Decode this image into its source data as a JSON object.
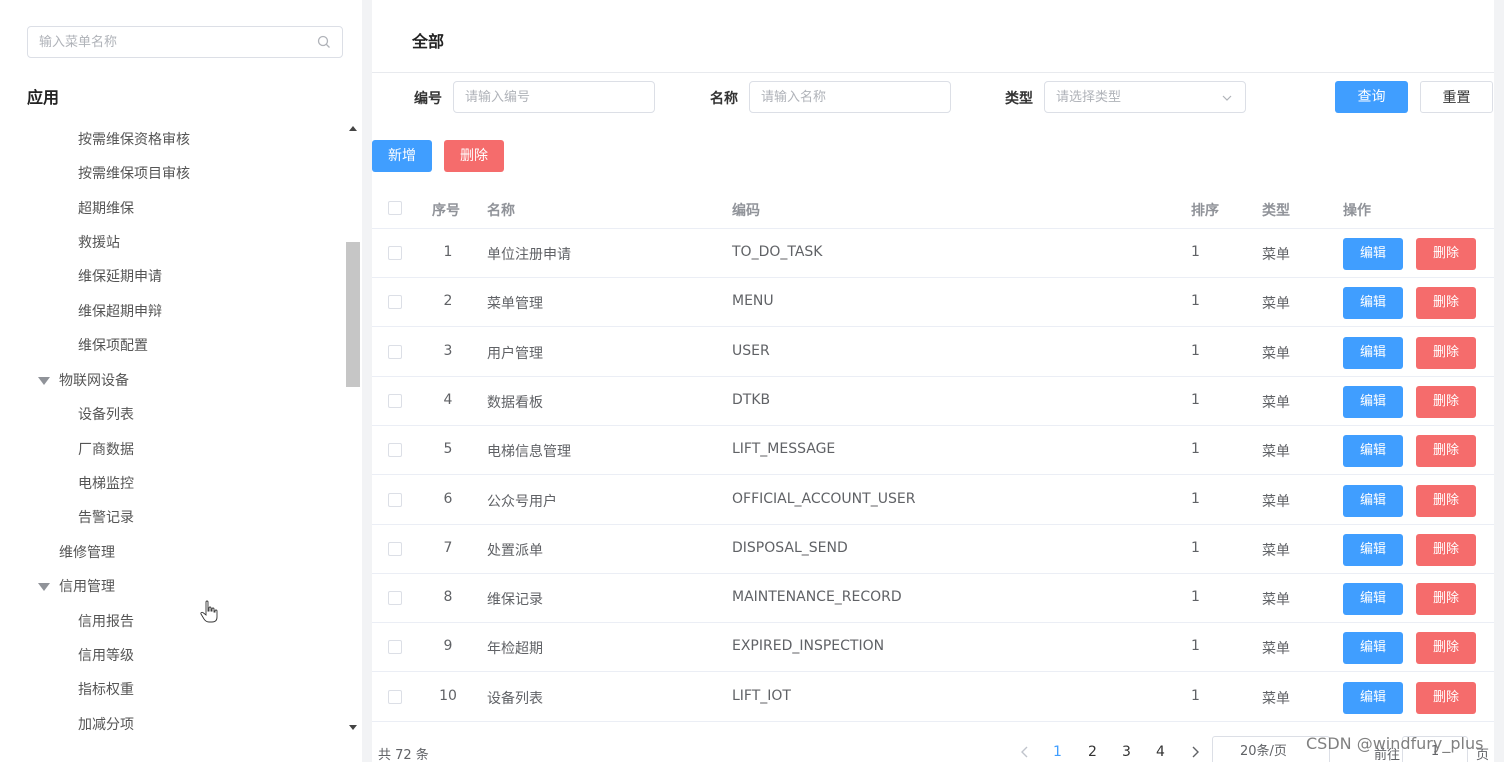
{
  "sidebar": {
    "search_placeholder": "输入菜单名称",
    "section_title": "应用",
    "tree": [
      {
        "label": "按需维保资格审核",
        "level": 2
      },
      {
        "label": "按需维保项目审核",
        "level": 2
      },
      {
        "label": "超期维保",
        "level": 2
      },
      {
        "label": "救援站",
        "level": 2
      },
      {
        "label": "维保延期申请",
        "level": 2
      },
      {
        "label": "维保超期申辩",
        "level": 2
      },
      {
        "label": "维保项配置",
        "level": 2
      },
      {
        "label": "物联网设备",
        "level": 1,
        "expanded": true
      },
      {
        "label": "设备列表",
        "level": 2
      },
      {
        "label": "厂商数据",
        "level": 2
      },
      {
        "label": "电梯监控",
        "level": 2
      },
      {
        "label": "告警记录",
        "level": 2
      },
      {
        "label": "维修管理",
        "level": 1
      },
      {
        "label": "信用管理",
        "level": 1,
        "expanded": true
      },
      {
        "label": "信用报告",
        "level": 2
      },
      {
        "label": "信用等级",
        "level": 2
      },
      {
        "label": "指标权重",
        "level": 2
      },
      {
        "label": "加减分项",
        "level": 2
      }
    ]
  },
  "main": {
    "title": "全部",
    "filters": {
      "code_label": "编号",
      "code_placeholder": "请输入编号",
      "name_label": "名称",
      "name_placeholder": "请输入名称",
      "type_label": "类型",
      "type_placeholder": "请选择类型",
      "query_label": "查询",
      "reset_label": "重置"
    },
    "toolbar": {
      "add_label": "新增",
      "delete_label": "删除"
    },
    "table": {
      "headers": {
        "index": "序号",
        "name": "名称",
        "code": "编码",
        "sort": "排序",
        "type": "类型",
        "ops": "操作"
      },
      "edit_label": "编辑",
      "delete_label": "删除",
      "rows": [
        {
          "index": "1",
          "name": "单位注册申请",
          "code": "TO_DO_TASK",
          "sort": "1",
          "type": "菜单"
        },
        {
          "index": "2",
          "name": "菜单管理",
          "code": "MENU",
          "sort": "1",
          "type": "菜单"
        },
        {
          "index": "3",
          "name": "用户管理",
          "code": "USER",
          "sort": "1",
          "type": "菜单"
        },
        {
          "index": "4",
          "name": "数据看板",
          "code": "DTKB",
          "sort": "1",
          "type": "菜单"
        },
        {
          "index": "5",
          "name": "电梯信息管理",
          "code": "LIFT_MESSAGE",
          "sort": "1",
          "type": "菜单"
        },
        {
          "index": "6",
          "name": "公众号用户",
          "code": "OFFICIAL_ACCOUNT_USER",
          "sort": "1",
          "type": "菜单"
        },
        {
          "index": "7",
          "name": "处置派单",
          "code": "DISPOSAL_SEND",
          "sort": "1",
          "type": "菜单"
        },
        {
          "index": "8",
          "name": "维保记录",
          "code": "MAINTENANCE_RECORD",
          "sort": "1",
          "type": "菜单"
        },
        {
          "index": "9",
          "name": "年检超期",
          "code": "EXPIRED_INSPECTION",
          "sort": "1",
          "type": "菜单"
        },
        {
          "index": "10",
          "name": "设备列表",
          "code": "LIFT_IOT",
          "sort": "1",
          "type": "菜单"
        }
      ]
    },
    "pagination": {
      "total": "共 72 条",
      "pages": [
        "1",
        "2",
        "3",
        "4"
      ],
      "active_page": "1",
      "page_size": "20条/页",
      "goto_label": "前往",
      "goto_value": "1",
      "page_suffix": "页"
    }
  },
  "watermark": "CSDN @windfury_plus",
  "colors": {
    "primary": "#409eff",
    "danger": "#f56c6c"
  }
}
